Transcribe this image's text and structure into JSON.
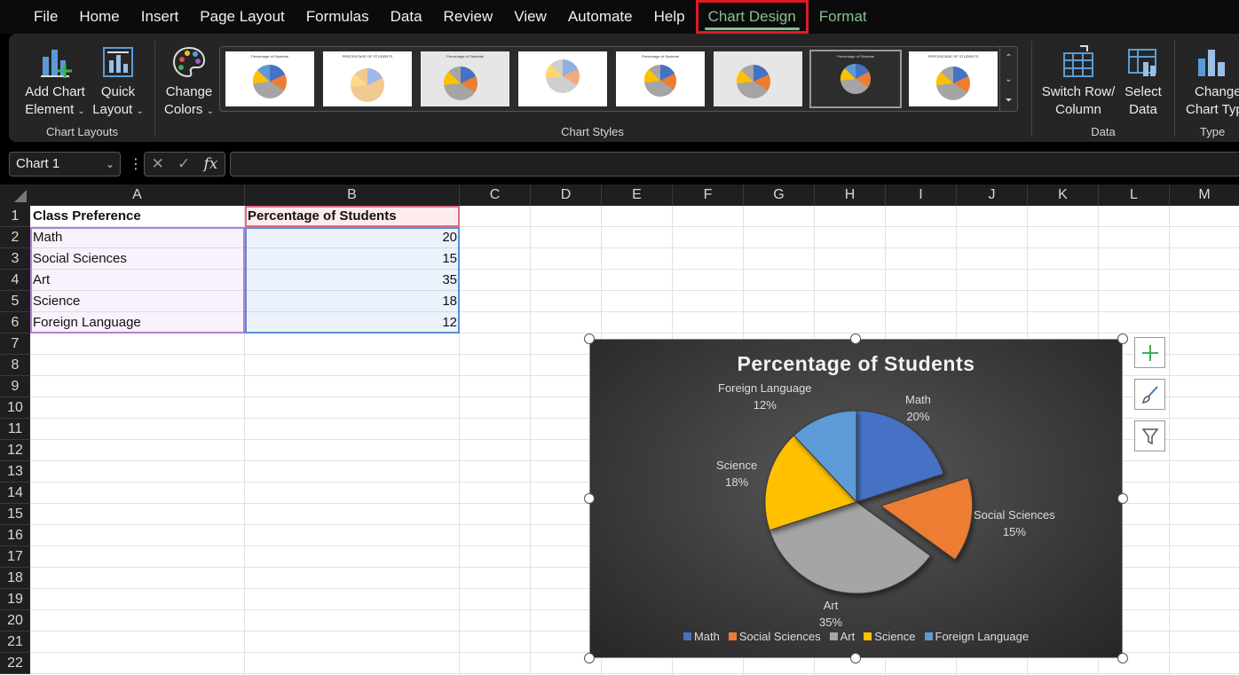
{
  "menu": {
    "items": [
      "File",
      "Home",
      "Insert",
      "Page Layout",
      "Formulas",
      "Data",
      "Review",
      "View",
      "Automate",
      "Help"
    ],
    "active": "Chart Design",
    "format": "Format"
  },
  "ribbon": {
    "add_chart_element": [
      "Add Chart",
      "Element"
    ],
    "quick_layout": [
      "Quick",
      "Layout"
    ],
    "chart_layouts_label": "Chart Layouts",
    "change_colors": [
      "Change",
      "Colors"
    ],
    "chart_styles_label": "Chart Styles",
    "thumb_title": "Percentage of Students",
    "thumb_title_caps": "PERCENTAGE OF STUDENTS",
    "switch_row_column": [
      "Switch Row/",
      "Column"
    ],
    "select_data": [
      "Select",
      "Data"
    ],
    "data_label": "Data",
    "change_chart_type": [
      "Change",
      "Chart Typ"
    ],
    "type_label": "Type"
  },
  "formula_bar": {
    "name_box": "Chart 1",
    "fx": "fx",
    "value": ""
  },
  "columns": [
    "A",
    "B",
    "C",
    "D",
    "E",
    "F",
    "G",
    "H",
    "I",
    "J",
    "K",
    "L",
    "M"
  ],
  "rows": [
    "1",
    "2",
    "3",
    "4",
    "5",
    "6",
    "7",
    "8",
    "9",
    "10",
    "11",
    "12",
    "13",
    "14",
    "15",
    "16",
    "17",
    "18",
    "19",
    "20",
    "21",
    "22"
  ],
  "sheet": {
    "header_a": "Class Preference",
    "header_b": "Percentage of Students",
    "data": [
      {
        "a": "Math",
        "b": "20"
      },
      {
        "a": "Social Sciences",
        "b": "15"
      },
      {
        "a": "Art",
        "b": "35"
      },
      {
        "a": "Science",
        "b": "18"
      },
      {
        "a": "Foreign Language",
        "b": "12"
      }
    ]
  },
  "chart_data": {
    "type": "pie",
    "title": "Percentage of Students",
    "categories": [
      "Math",
      "Social Sciences",
      "Art",
      "Science",
      "Foreign Language"
    ],
    "values": [
      20,
      15,
      35,
      18,
      12
    ],
    "labels": [
      "20%",
      "15%",
      "35%",
      "18%",
      "12%"
    ],
    "colors": [
      "#4472c4",
      "#ed7d31",
      "#a5a5a5",
      "#ffc000",
      "#5b9bd5"
    ],
    "exploded": "Social Sciences",
    "legend": "bottom"
  }
}
